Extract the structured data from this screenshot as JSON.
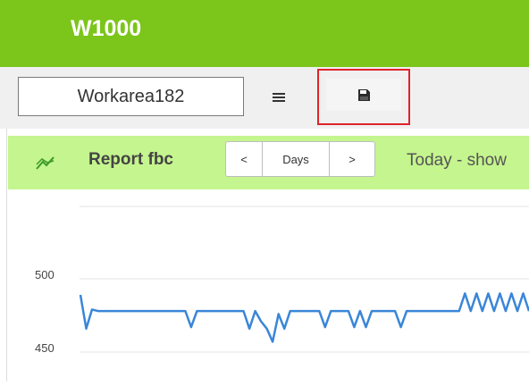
{
  "app": {
    "title": "W1000",
    "accent_color": "#7cc51b"
  },
  "toolbar": {
    "workarea_name": "Workarea182",
    "menu_icon": "hamburger-menu-icon",
    "save_icon": "floppy-disk-icon",
    "highlight_color": "#e0232a"
  },
  "report": {
    "icon": "line-chart-icon",
    "title": "Report fbc",
    "nav": {
      "prev": "<",
      "period": "Days",
      "next": ">"
    },
    "range_text": "Today - show",
    "header_color": "#c5f58e"
  },
  "chart_data": {
    "type": "line",
    "y_ticks": [
      "500",
      "450"
    ],
    "ylim": [
      440,
      540
    ],
    "grid": true,
    "series": [
      {
        "color": "#3a86d8",
        "values": [
          489,
          466,
          479,
          478,
          478,
          478,
          478,
          478,
          478,
          478,
          478,
          478,
          478,
          478,
          478,
          478,
          478,
          478,
          478,
          467,
          478,
          478,
          478,
          478,
          478,
          478,
          478,
          478,
          478,
          466,
          478,
          471,
          466,
          457,
          476,
          466,
          478,
          478,
          478,
          478,
          478,
          478,
          467,
          478,
          478,
          478,
          478,
          467,
          478,
          467,
          478,
          478,
          478,
          478,
          478,
          467,
          478,
          478,
          478,
          478,
          478,
          478,
          478,
          478,
          478,
          478,
          490,
          478,
          490,
          478,
          490,
          478,
          490,
          478,
          490,
          478,
          490,
          478
        ]
      }
    ]
  }
}
